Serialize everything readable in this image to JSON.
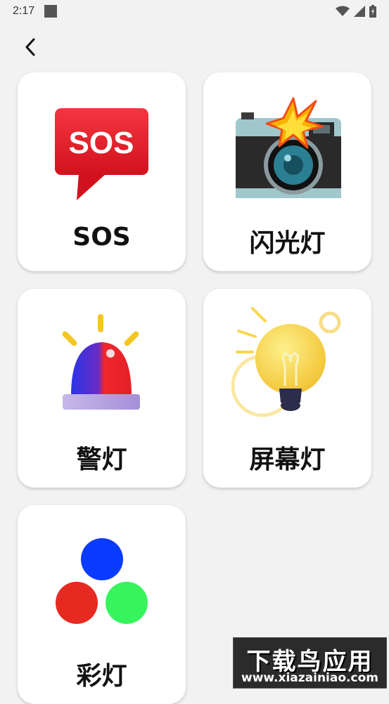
{
  "status_bar": {
    "time": "2:17",
    "icons": [
      "notification-square-icon",
      "wifi-icon",
      "signal-icon",
      "battery-icon"
    ]
  },
  "header": {
    "back_icon": "chevron-left-icon"
  },
  "cards": [
    {
      "label": "SOS",
      "icon": "sos-bubble-icon"
    },
    {
      "label": "闪光灯",
      "icon": "camera-flash-icon"
    },
    {
      "label": "警灯",
      "icon": "police-siren-icon"
    },
    {
      "label": "屏幕灯",
      "icon": "light-bulb-icon"
    },
    {
      "label": "彩灯",
      "icon": "rgb-circles-icon"
    }
  ],
  "watermark": {
    "title": "下载鸟应用",
    "url": "www.xiazainiao.com"
  },
  "colors": {
    "background": "#f2f2f2",
    "card": "#ffffff",
    "sos_red": "#e5202e",
    "siren_red": "#f0282d",
    "siren_blue": "#2b34e6",
    "bulb_yellow": "#f8d74a",
    "dot_blue": "#0a3cff",
    "dot_red": "#e72a21",
    "dot_green": "#38f45c"
  }
}
